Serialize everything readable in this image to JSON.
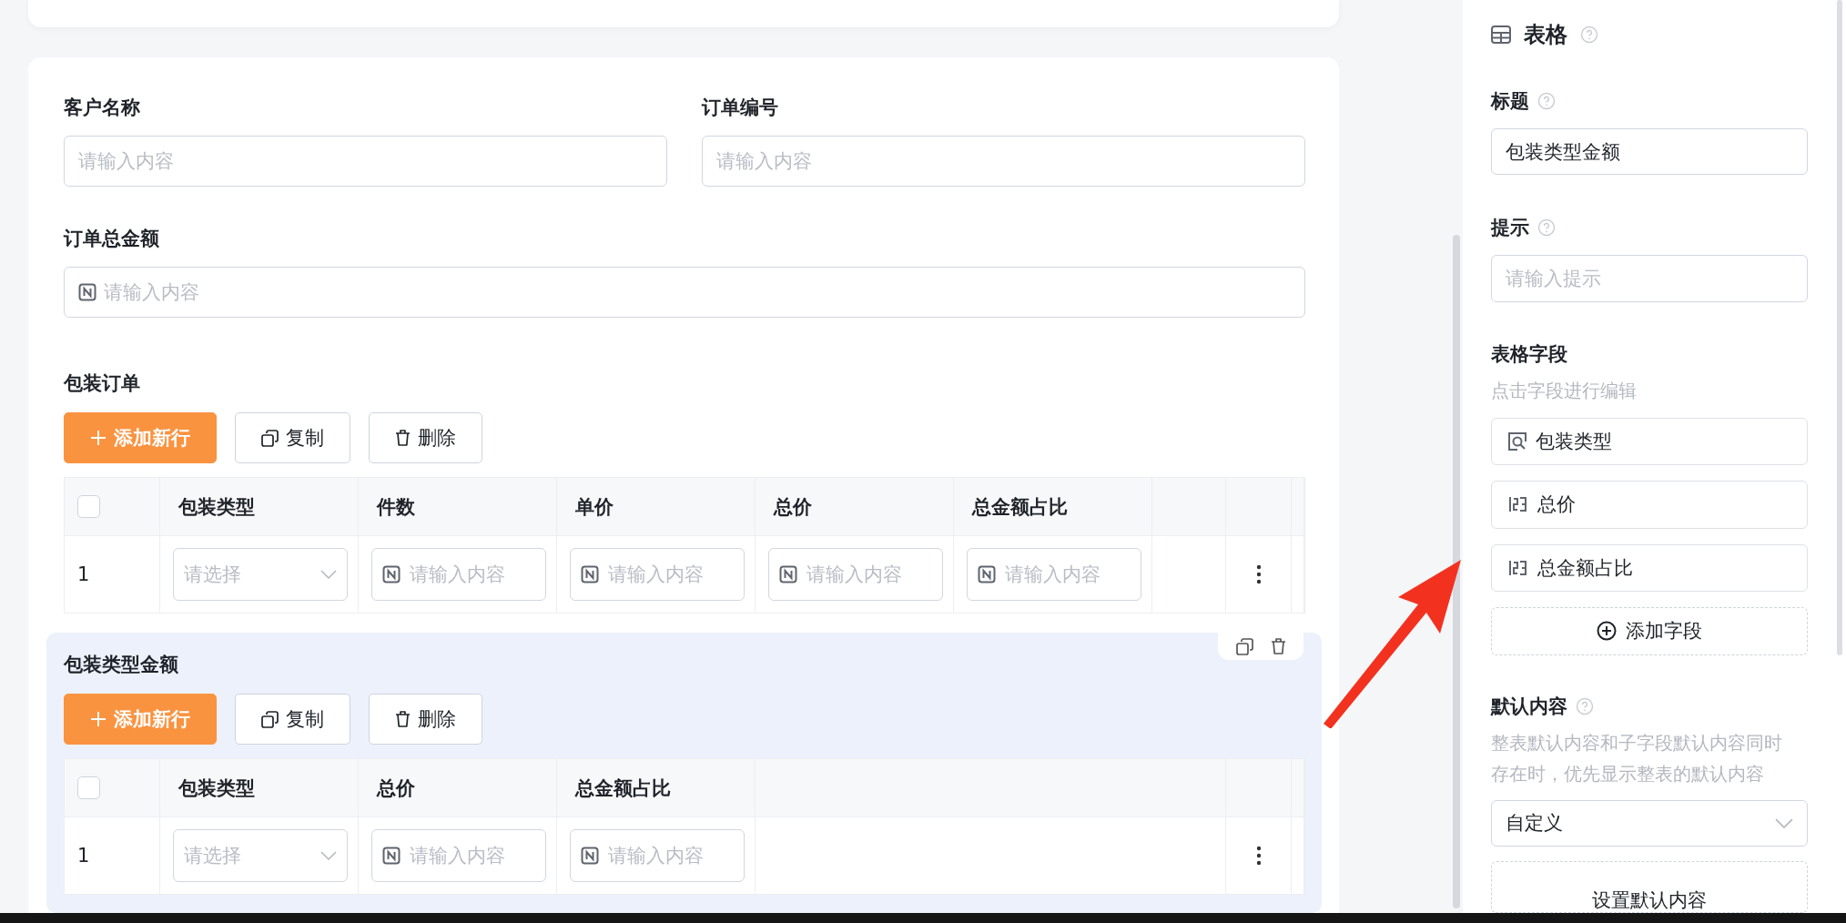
{
  "form": {
    "fields": [
      {
        "label": "客户名称",
        "placeholder": "请输入内容",
        "kind": "text"
      },
      {
        "label": "订单编号",
        "placeholder": "请输入内容",
        "kind": "text"
      },
      {
        "label": "订单总金额",
        "placeholder": "请输入内容",
        "kind": "number"
      }
    ]
  },
  "subtables": [
    {
      "title": "包装订单",
      "selected": false,
      "buttons": [
        {
          "label": "添加新行",
          "kind": "primary"
        },
        {
          "label": "复制",
          "kind": "copy"
        },
        {
          "label": "删除",
          "kind": "delete"
        }
      ],
      "header_checked": false,
      "columns": [
        "包装类型",
        "件数",
        "单价",
        "总价",
        "总金额占比"
      ],
      "rows": [
        {
          "index": "1",
          "cells": [
            {
              "kind": "select",
              "placeholder": "请选择"
            },
            {
              "kind": "number",
              "placeholder": "请输入内容"
            },
            {
              "kind": "number",
              "placeholder": "请输入内容"
            },
            {
              "kind": "number",
              "placeholder": "请输入内容"
            },
            {
              "kind": "number",
              "placeholder": "请输入内容"
            }
          ]
        }
      ]
    },
    {
      "title": "包装类型金额",
      "selected": true,
      "buttons": [
        {
          "label": "添加新行",
          "kind": "primary"
        },
        {
          "label": "复制",
          "kind": "copy"
        },
        {
          "label": "删除",
          "kind": "delete"
        }
      ],
      "header_checked": false,
      "columns": [
        "包装类型",
        "总价",
        "总金额占比"
      ],
      "rows": [
        {
          "index": "1",
          "cells": [
            {
              "kind": "select",
              "placeholder": "请选择"
            },
            {
              "kind": "number",
              "placeholder": "请输入内容"
            },
            {
              "kind": "number",
              "placeholder": "请输入内容"
            }
          ]
        }
      ]
    }
  ],
  "panel": {
    "heading": "表格",
    "title": {
      "label": "标题",
      "value": "包装类型金额"
    },
    "hint": {
      "label": "提示",
      "placeholder": "请输入提示"
    },
    "fields": {
      "label": "表格字段",
      "description": "点击字段进行编辑",
      "items": [
        {
          "label": "包装类型",
          "kind": "select"
        },
        {
          "label": "总价",
          "kind": "number"
        },
        {
          "label": "总金额占比",
          "kind": "number"
        }
      ],
      "add_button": "添加字段"
    },
    "default": {
      "label": "默认内容",
      "description": "整表默认内容和子字段默认内容同时存在时，优先显示整表的默认内容",
      "value": "自定义",
      "button": "设置默认内容"
    }
  }
}
